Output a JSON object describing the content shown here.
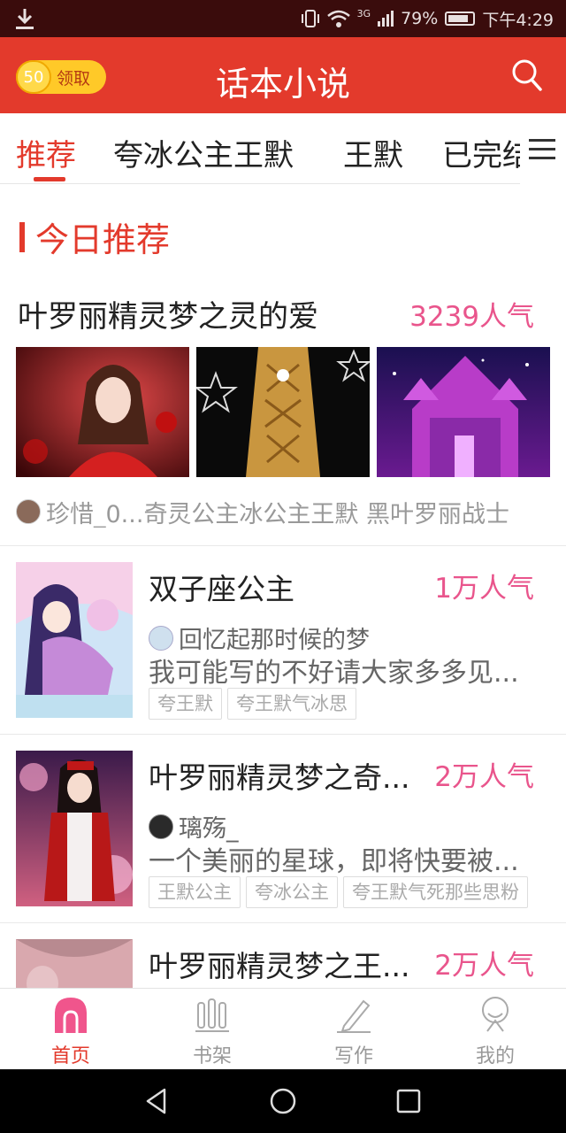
{
  "status_bar": {
    "network": "3G",
    "battery": "79%",
    "time": "下午4:29"
  },
  "app_bar": {
    "coin_count": "50",
    "coin_label": "领取",
    "title": "话本小说"
  },
  "tabs": [
    {
      "label": "推荐",
      "active": true
    },
    {
      "label": "夸冰公主王默",
      "active": false
    },
    {
      "label": "王默",
      "active": false
    },
    {
      "label": "已完结",
      "active": false
    }
  ],
  "section": {
    "title": "今日推荐"
  },
  "featured": {
    "title": "叶罗丽精灵梦之灵的爱",
    "popularity": "3239人气",
    "byline": "珍惜_0...",
    "tags_line": "奇灵公主冰公主王默  黑叶罗丽战士"
  },
  "books": [
    {
      "title": "双子座公主",
      "popularity": "1万人气",
      "author": "回忆起那时候的梦",
      "description": "我可能写的不好请大家多多见...",
      "tags": [
        "夸王默",
        "夸王默气冰思"
      ]
    },
    {
      "title": "叶罗丽精灵梦之奇...",
      "popularity": "2万人气",
      "author": "璃殇_",
      "description": "一个美丽的星球，即将快要被...",
      "tags": [
        "王默公主",
        "夸冰公主",
        "夸王默气死那些思粉"
      ]
    },
    {
      "title": "叶罗丽精灵梦之王...",
      "popularity": "2万人气",
      "author": "",
      "description": "",
      "tags": []
    }
  ],
  "bottom_nav": [
    {
      "label": "首页",
      "icon": "home-icon",
      "active": true
    },
    {
      "label": "书架",
      "icon": "bookshelf-icon",
      "active": false
    },
    {
      "label": "写作",
      "icon": "pen-icon",
      "active": false
    },
    {
      "label": "我的",
      "icon": "profile-icon",
      "active": false
    }
  ],
  "colors": {
    "brand_red": "#e33a2c",
    "popularity_pink": "#e9558c",
    "status_bar": "#3a0c0c",
    "coin_yellow": "#ffc928"
  }
}
